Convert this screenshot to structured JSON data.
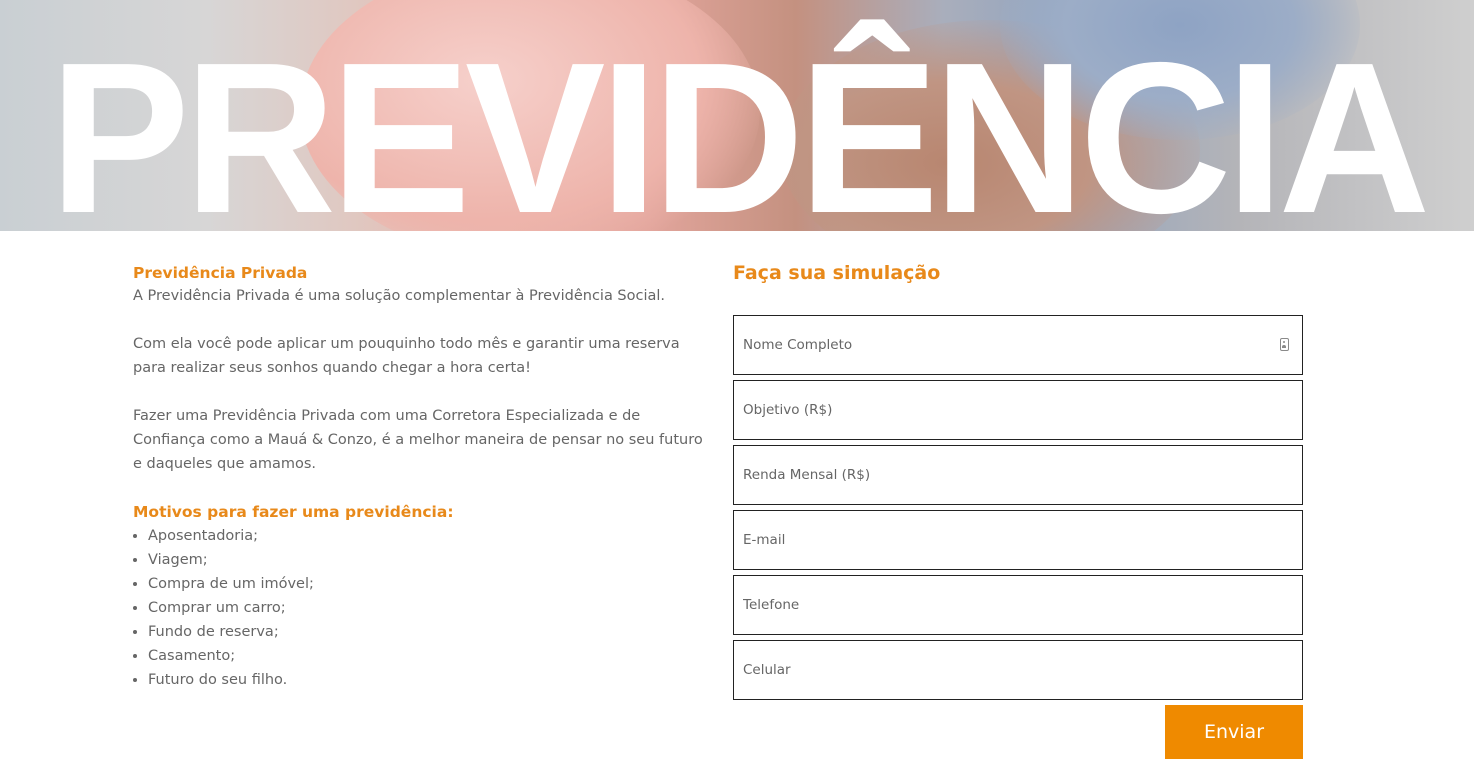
{
  "hero": {
    "title": "PREVIDÊNCIA"
  },
  "info": {
    "heading": "Previdência Privada",
    "paragraphs": [
      "A Previdência Privada é uma solução complementar à Previdência Social.",
      "Com ela você pode aplicar um pouquinho todo mês e garantir uma reserva para realizar seus sonhos quando chegar a hora certa!",
      "Fazer uma Previdência Privada com uma Corretora Especializada e de Confiança como a Mauá & Conzo, é a melhor maneira de pensar no seu futuro e daqueles que amamos."
    ],
    "reasons_heading": "Motivos para fazer uma previdência:",
    "reasons": [
      "Aposentadoria;",
      "Viagem;",
      "Compra de um imóvel;",
      "Comprar um carro;",
      "Fundo de reserva;",
      "Casamento;",
      "Futuro do seu filho."
    ]
  },
  "form": {
    "title": "Faça sua simulação",
    "fields": [
      {
        "placeholder": "Nome Completo",
        "value": ""
      },
      {
        "placeholder": "Objetivo (R$)",
        "value": ""
      },
      {
        "placeholder": "Renda Mensal (R$)",
        "value": ""
      },
      {
        "placeholder": "E-mail",
        "value": ""
      },
      {
        "placeholder": "Telefone",
        "value": ""
      },
      {
        "placeholder": "Celular",
        "value": ""
      }
    ],
    "submit_label": "Enviar",
    "icons": {
      "name_field": "contact-card-icon"
    }
  },
  "colors": {
    "accent": "#e8891a",
    "button": "#ef8a00",
    "body_text": "#666666"
  }
}
